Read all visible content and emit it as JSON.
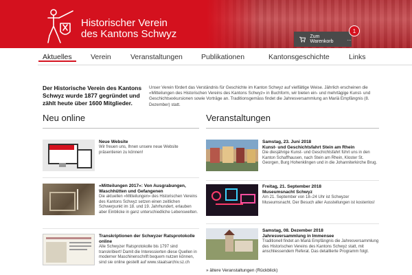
{
  "header": {
    "brand_line1": "Historischer Verein",
    "brand_line2": "des Kantons Schwyz",
    "cart_label": "Zum Warenkorb",
    "cart_count": "1"
  },
  "nav": {
    "items": [
      "Aktuelles",
      "Verein",
      "Veranstaltungen",
      "Publikationen",
      "Kantonsgeschichte",
      "Links"
    ]
  },
  "intro": {
    "title": "Der Historische Verein des Kantons Schwyz wurde 1877 gegründet und zählt heute über 1600 Mitglieder.",
    "text": "Unser Verein fördert das Verständnis für Geschichte im Kanton Schwyz auf vielfältige Weise. Jährlich erscheinen die «Mitteilungen des Historischen Vereins des Kantons Schwyz» in Buchform, wir bieten ein- und mehrtägige Kunst- und Geschichtsexkursionen sowie Vorträge an. Traditionsgemäss findet die Jahresversammlung an Mariä Empfängnis (8. Dezember) statt."
  },
  "neu_online": {
    "heading": "Neu online",
    "items": [
      {
        "title": "Neue Website",
        "text": "Wir freuen uns, Ihnen unsere neue Website präsentieren zu können!"
      },
      {
        "title": "«Mitteilungen 2017»: Von Ausgrabungen, Waschhütten und Gefangenen",
        "text": "Die aktuellen «Mitteilungen» des Historischen Vereins des Kantons Schwyz setzen einen zeitlichen Schwerpunkt im 18. und 19. Jahrhundert, erlauben aber Einblicke in ganz unterschiedliche Lebenswelten."
      },
      {
        "title": "Transkriptionen der Schwyzer Ratsprotokolle online",
        "text": "Alle Schwyzer Ratsprotokolle bis 1797 sind transkribiert! Damit die Interessierten diese Quellen in moderner Maschinenschrift bequem nutzen können, sind sie online gestellt auf www.staatsarchiv.sz.ch"
      }
    ]
  },
  "veranstaltungen": {
    "heading": "Veranstaltungen",
    "items": [
      {
        "date": "Samstag, 23. Juni 2018",
        "title": "Kunst- und Geschichtsfahrt Stein am Rhein",
        "text": "Die diesjährige Kunst- und Geschichtsfahrt führt uns in den Kanton Schaffhausen, nach Stein am Rhein, Kloster St. Georgen, Burg Hohenklingen und in die Johanniterkirche Brug."
      },
      {
        "date": "Freitag, 21. September 2018",
        "title": "Museumsnacht Schwyz",
        "text": "Am 21. September von 18–24 Uhr ist Schwyzer Museumsnacht. Der Besuch aller Ausstellungen ist kostenlos!"
      },
      {
        "date": "Samstag, 08. Dezember 2018",
        "title": "Jahresversammlung in Immensee",
        "text": "Traditionell findet an Mariä Empfängnis die Jahresversammlung des Historischen Vereins des Kantons Schwyz statt, mit anschliessendem Referat. Das detaillierte Programm folgt."
      }
    ],
    "more_link": "» ältere Veranstaltungen (Rückblick)"
  },
  "colors": {
    "accent": "#d4111e",
    "cart_bg": "#4a4a4a"
  }
}
